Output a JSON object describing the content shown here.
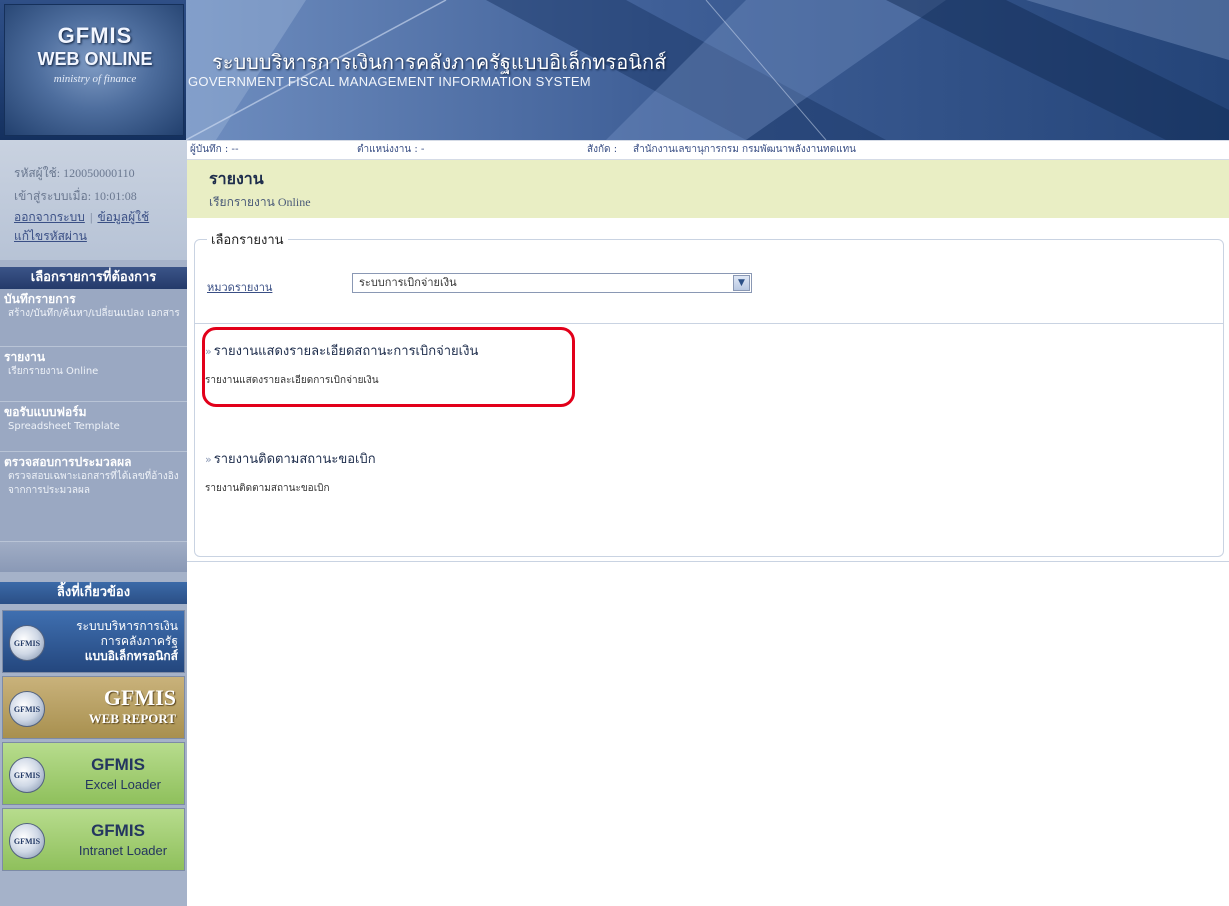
{
  "header": {
    "logo_title": "GFMIS",
    "logo_sub": "WEB ONLINE",
    "logo_tag": "ministry of finance",
    "system_title_th": "ระบบบริหารการเงินการคลังภาครัฐแบบอิเล็กทรอนิกส์",
    "system_title_en": "GOVERNMENT FISCAL MANAGEMENT INFORMATION SYSTEM"
  },
  "user": {
    "user_id_label": "รหัสผู้ใช้:",
    "user_id": "120050000110",
    "login_label": "เข้าสู่ระบบเมื่อ:",
    "login_time": "10:01:08",
    "logout_link": "ออกจากระบบ",
    "separator": "|",
    "user_info_link": "ข้อมูลผู้ใช้",
    "change_password_link": "แก้ไขรหัสผ่าน"
  },
  "menu": {
    "title": "เลือกรายการที่ต้องการ",
    "items": [
      {
        "title": "บันทึกรายการ",
        "desc": "สร้าง/บันทึก/ค้นหา/เปลี่ยนแปลง เอกสาร"
      },
      {
        "title": "รายงาน",
        "desc": "เรียกรายงาน Online"
      },
      {
        "title": "ขอรับแบบฟอร์ม",
        "desc": "Spreadsheet Template"
      },
      {
        "title": "ตรวจสอบการประมวลผล",
        "desc": "ตรวจสอบเฉพาะเอกสารที่ได้เลขที่อ้างอิงจากการประมวลผล"
      }
    ]
  },
  "links": {
    "title": "ลิ้งที่เกี่ยวข้อง",
    "logo_text": "GFMIS",
    "gfmis_main_line1": "ระบบบริหารการเงิน",
    "gfmis_main_line2": "การคลังภาครัฐ",
    "gfmis_main_line3": "แบบอิเล็กทรอนิกส์",
    "web_report_line1": "GFMIS",
    "web_report_line2": "WEB REPORT",
    "excel_loader_line1": "GFMIS",
    "excel_loader_line2": "Excel Loader",
    "intranet_loader_line1": "GFMIS",
    "intranet_loader_line2": "Intranet Loader"
  },
  "info_bar": {
    "recorder_label": "ผู้บันทึก : --",
    "position_label": "ตำแหน่งงาน : -",
    "affiliation_label": "สังกัด :",
    "affiliation_value": "สำนักงานเลขานุการกรม กรมพัฒนาพลังงานทดแทน"
  },
  "page": {
    "title": "รายงาน",
    "subtitle": "เรียกรายงาน Online",
    "fieldset_legend": "เลือกรายงาน",
    "category_label": "หมวดรายงาน",
    "category_selected": "ระบบการเบิกจ่ายเงิน"
  },
  "reports": [
    {
      "title": "รายงานแสดงรายละเอียดสถานะการเบิกจ่ายเงิน",
      "desc": "รายงานแสดงรายละเอียดการเบิกจ่ายเงิน"
    },
    {
      "title": "รายงานติดตามสถานะขอเบิก",
      "desc": "รายงานติดตามสถานะขอเบิก"
    }
  ],
  "colors": {
    "highlight": "#e2001a",
    "header_blue": "#25457c",
    "page_header_bg": "#e9eec4"
  }
}
